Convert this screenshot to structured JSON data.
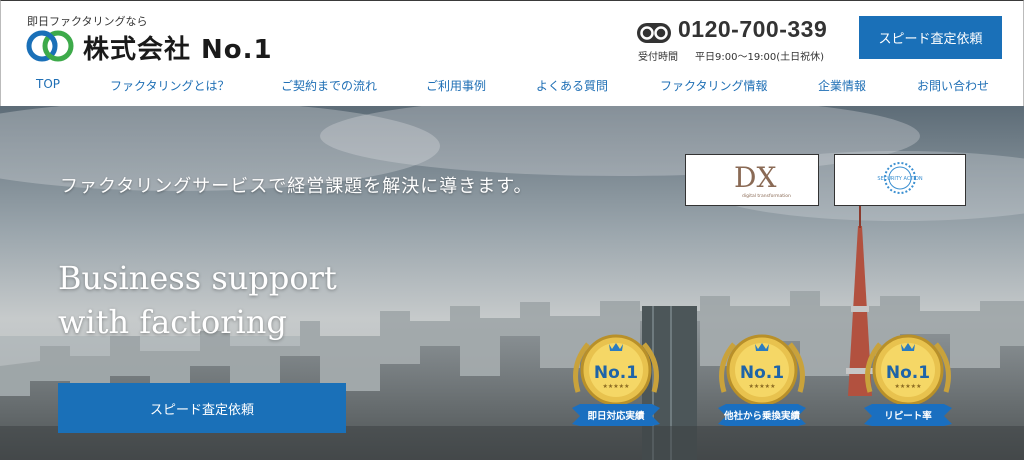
{
  "header": {
    "tagline": "即日ファクタリングなら",
    "company_name": "株式会社 No.1",
    "phone": "0120-700-339",
    "hours_label": "受付時間",
    "hours": "平日9:00〜19:00(土日祝休)",
    "cta_label": "スピード査定依頼",
    "icons": {
      "logo": "swirl-logo-icon",
      "phone": "free-dial-icon"
    },
    "colors": {
      "accent": "#1a70b8",
      "nav_text": "#1f6fb5"
    }
  },
  "nav": {
    "items": [
      {
        "label": "TOP"
      },
      {
        "label": "ファクタリングとは？"
      },
      {
        "label": "ご契約までの流れ"
      },
      {
        "label": "ご利用事例"
      },
      {
        "label": "よくある質問"
      },
      {
        "label": "ファクタリング情報"
      },
      {
        "label": "企業情報"
      },
      {
        "label": "お問い合わせ"
      }
    ]
  },
  "hero": {
    "subtitle": "ファクタリングサービスで経営課題を解決に導きます。",
    "title_line1": "Business support",
    "title_line2": "with factoring",
    "cta_label": "スピード査定依頼",
    "badges": {
      "dx": {
        "mark": "DX",
        "sub": "digital transformation"
      },
      "security": {
        "text": "SECURITY ACTION"
      }
    },
    "medals": [
      {
        "rank": "No.1",
        "label": "即日対応実績"
      },
      {
        "rank": "No.1",
        "label": "他社から乗換実績"
      },
      {
        "rank": "No.1",
        "label": "リピート率"
      }
    ]
  }
}
